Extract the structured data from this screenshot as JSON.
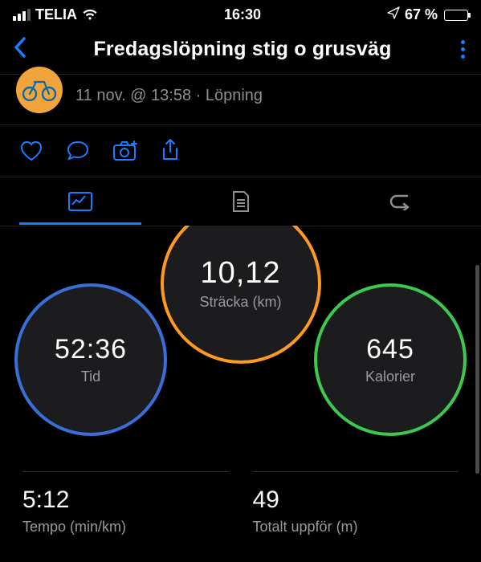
{
  "status": {
    "carrier": "TELIA",
    "time": "16:30",
    "battery_text": "67 %",
    "battery_pct": 67
  },
  "nav": {
    "title": "Fredagslöpning stig o grusväg"
  },
  "activity": {
    "subtitle": "11 nov. @ 13:58 · Löpning"
  },
  "circles": {
    "center_value": "10,12",
    "center_label": "Sträcka (km)",
    "left_value": "52:36",
    "left_label": "Tid",
    "right_value": "645",
    "right_label": "Kalorier"
  },
  "stats": {
    "pace_value": "5:12",
    "pace_label": "Tempo (min/km)",
    "ascent_value": "49",
    "ascent_label": "Totalt uppför (m)"
  }
}
